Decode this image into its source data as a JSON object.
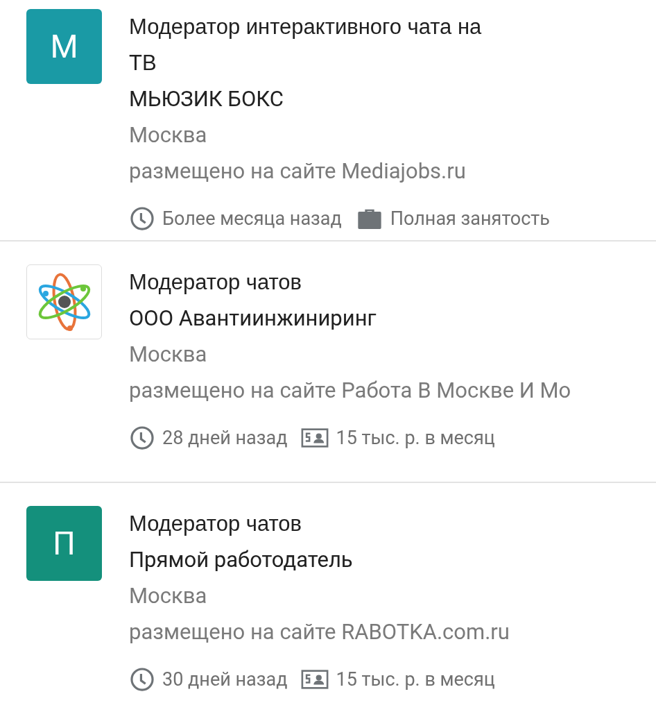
{
  "jobs": [
    {
      "logo": {
        "kind": "letter",
        "letter": "М",
        "color": "#1a9aa5"
      },
      "title": "Модератор интерактивного чата на ТВ",
      "company": "МЬЮЗИК БОКС",
      "city": "Москва",
      "source": "размещено на сайте Mediajobs.ru",
      "meta": [
        {
          "kind": "time",
          "text": "Более месяца назад"
        },
        {
          "kind": "employment",
          "text": "Полная занятость"
        }
      ]
    },
    {
      "logo": {
        "kind": "image"
      },
      "title": "Модератор чатов",
      "company": "ООО Авантиинжиниринг",
      "city": "Москва",
      "source": "размещено на сайте Работа В Москве И Мо",
      "meta": [
        {
          "kind": "time",
          "text": "28 дней назад"
        },
        {
          "kind": "salary",
          "text": "15 тыс. р. в месяц"
        }
      ]
    },
    {
      "logo": {
        "kind": "letter",
        "letter": "П",
        "color": "#14907c"
      },
      "title": "Модератор чатов",
      "company": "Прямой работодатель",
      "city": "Москва",
      "source": "размещено на сайте RABOTKA.com.ru",
      "meta": [
        {
          "kind": "time",
          "text": "30 дней назад"
        },
        {
          "kind": "salary",
          "text": "15 тыс. р. в месяц"
        }
      ]
    }
  ]
}
